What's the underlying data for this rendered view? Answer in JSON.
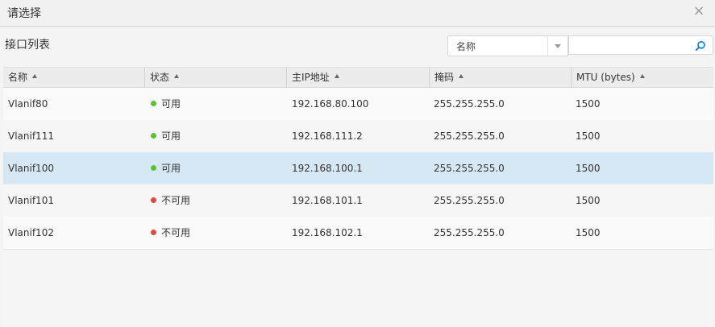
{
  "dialog": {
    "title": "请选择",
    "close_glyph": "×"
  },
  "section_title": "接口列表",
  "search": {
    "field_select_value": "名称",
    "input_value": "",
    "icon": "search-icon"
  },
  "columns": [
    {
      "label": "名称"
    },
    {
      "label": "状态"
    },
    {
      "label": "主IP地址"
    },
    {
      "label": "掩码"
    },
    {
      "label": "MTU (bytes)"
    }
  ],
  "status_colors": {
    "available": "#5bc236",
    "unavailable": "#e8473d"
  },
  "selection_color": "#d6e8f4",
  "rows": [
    {
      "name": "Vlanif80",
      "status": "可用",
      "status_key": "available",
      "ip": "192.168.80.100",
      "mask": "255.255.255.0",
      "mtu": "1500",
      "selected": false
    },
    {
      "name": "Vlanif111",
      "status": "可用",
      "status_key": "available",
      "ip": "192.168.111.2",
      "mask": "255.255.255.0",
      "mtu": "1500",
      "selected": false
    },
    {
      "name": "Vlanif100",
      "status": "可用",
      "status_key": "available",
      "ip": "192.168.100.1",
      "mask": "255.255.255.0",
      "mtu": "1500",
      "selected": true
    },
    {
      "name": "Vlanif101",
      "status": "不可用",
      "status_key": "unavailable",
      "ip": "192.168.101.1",
      "mask": "255.255.255.0",
      "mtu": "1500",
      "selected": false
    },
    {
      "name": "Vlanif102",
      "status": "不可用",
      "status_key": "unavailable",
      "ip": "192.168.102.1",
      "mask": "255.255.255.0",
      "mtu": "1500",
      "selected": false
    }
  ]
}
